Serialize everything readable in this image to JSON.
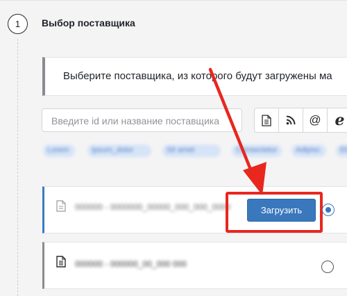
{
  "step": {
    "number": "1",
    "title": "Выбор поставщика"
  },
  "info": {
    "text": "Выберите поставщика, из которого будут загружены ма"
  },
  "search": {
    "placeholder": "Введите id или название поставщика"
  },
  "toolbar": {
    "icons": [
      "document-icon",
      "rss-icon",
      "at-icon",
      "browser-e-icon"
    ],
    "glyphs": {
      "rss": "≋",
      "at": "@",
      "e": "e"
    }
  },
  "tags": [
    "Lorem",
    "Ipsum_dolor",
    "Sit amet",
    "Consectetur",
    "Adipisc",
    "Elit"
  ],
  "suppliers": [
    {
      "name": "000000 - 0000000_00000_000_000_0000",
      "selected": true
    },
    {
      "name": "000000 - 000000_00_000 000",
      "selected": false
    }
  ],
  "actions": {
    "load_label": "Загрузить"
  },
  "colors": {
    "accent": "#3a78bd",
    "highlight": "#e8271f"
  }
}
